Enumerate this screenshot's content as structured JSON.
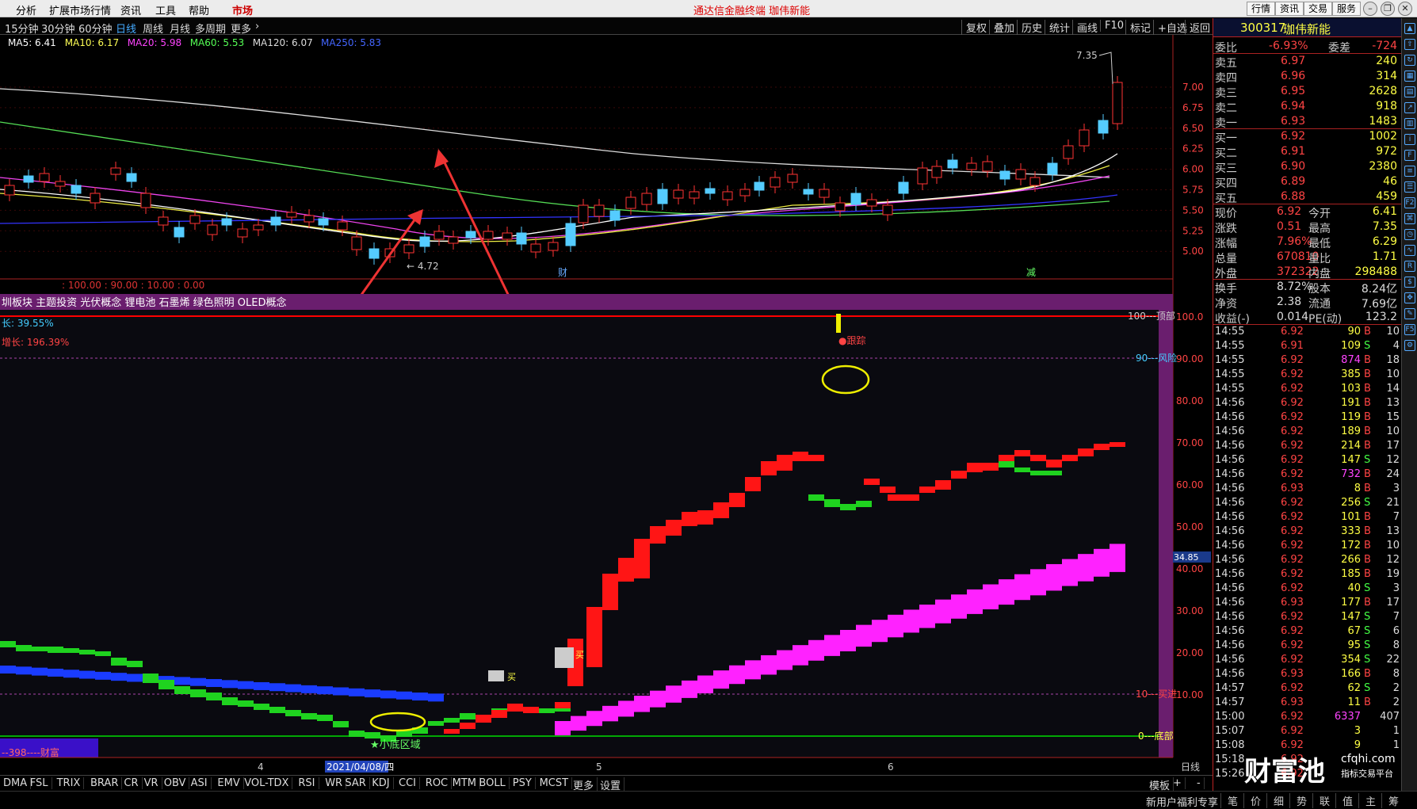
{
  "menu": {
    "items": [
      "分析",
      "扩展市场行情",
      "资讯",
      "工具",
      "帮助"
    ],
    "market": "市场",
    "title": "通达信金融终端 珈伟新能",
    "right_buttons": [
      "行情",
      "资讯",
      "交易",
      "服务"
    ],
    "window_icons": [
      "minimize-icon",
      "restore-icon",
      "close-icon"
    ]
  },
  "toolbar": {
    "periods": [
      "15分钟",
      "30分钟",
      "60分钟",
      "日线",
      "周线",
      "月线",
      "多周期",
      "更多"
    ],
    "active_period": "日线",
    "right_buttons": [
      "复权",
      "叠加",
      "历史",
      "统计",
      "画线",
      "F10",
      "标记",
      "+自选",
      "返回"
    ]
  },
  "ma_legend": [
    {
      "label": "MA5: 6.41",
      "color": "#ffffff"
    },
    {
      "label": "MA10: 6.17",
      "color": "#ffff55"
    },
    {
      "label": "MA20: 5.98",
      "color": "#ff44ff"
    },
    {
      "label": "MA60: 5.53",
      "color": "#55ff55"
    },
    {
      "label": "MA120: 6.07",
      "color": "#dddddd"
    },
    {
      "label": "MA250: 5.83",
      "color": "#4466ff"
    }
  ],
  "price_axis": [
    "7.00",
    "6.75",
    "6.50",
    "6.25",
    "6.00",
    "5.75",
    "5.50",
    "5.25",
    "5.00"
  ],
  "price_labels": {
    "high": "7.35",
    "low": "4.72",
    "marker_cai": "财",
    "marker_jian": "减"
  },
  "indicator_ticker": ": 100.00 : 90.00 : 10.00 : 0.00",
  "concept_strip": "圳板块 主题投资 光伏概念 锂电池 石墨烯 绿色照明 OLED概念",
  "indicator_texts": {
    "stat1": "长: 39.55%",
    "stat2": "增长: 196.39%",
    "top_label": "100---顶部",
    "risk_label": "90---风险",
    "buy_label": "10---买进",
    "bottom_label": "0---底部",
    "track_label": "●跟踪",
    "buy_marker": "买",
    "small_bottom": "★小底区域",
    "wealth": "--398----财富",
    "axis_value": "34.85"
  },
  "indicator_axis": [
    "100.0",
    "90.00",
    "80.00",
    "70.00",
    "60.00",
    "50.00",
    "40.00",
    "30.00",
    "20.00",
    "10.00"
  ],
  "date_axis": {
    "m4": "4",
    "date": "2021/04/08/四",
    "m5": "5",
    "m6": "6",
    "period": "日线"
  },
  "quote": {
    "code": "300317",
    "name": "珈伟新能",
    "weibi": {
      "label": "委比",
      "value": "-6.93%",
      "label2": "委差",
      "value2": "-724"
    },
    "asks": [
      {
        "label": "卖五",
        "price": "6.97",
        "vol": "240"
      },
      {
        "label": "卖四",
        "price": "6.96",
        "vol": "314"
      },
      {
        "label": "卖三",
        "price": "6.95",
        "vol": "2628"
      },
      {
        "label": "卖二",
        "price": "6.94",
        "vol": "918"
      },
      {
        "label": "卖一",
        "price": "6.93",
        "vol": "1483"
      }
    ],
    "bids": [
      {
        "label": "买一",
        "price": "6.92",
        "vol": "1002"
      },
      {
        "label": "买二",
        "price": "6.91",
        "vol": "972"
      },
      {
        "label": "买三",
        "price": "6.90",
        "vol": "2380"
      },
      {
        "label": "买四",
        "price": "6.89",
        "vol": "46"
      },
      {
        "label": "买五",
        "price": "6.88",
        "vol": "459"
      }
    ],
    "stats": [
      {
        "l1": "现价",
        "v1": "6.92",
        "l2": "今开",
        "v2": "6.41"
      },
      {
        "l1": "涨跌",
        "v1": "0.51",
        "l2": "最高",
        "v2": "7.35"
      },
      {
        "l1": "涨幅",
        "v1": "7.96%",
        "l2": "最低",
        "v2": "6.29"
      },
      {
        "l1": "总量",
        "v1": "670810",
        "l2": "量比",
        "v2": "1.71"
      },
      {
        "l1": "外盘",
        "v1": "372322",
        "l2": "内盘",
        "v2": "298488"
      }
    ],
    "stats2": [
      {
        "l1": "换手",
        "v1": "8.72%",
        "l2": "股本",
        "v2": "8.24亿"
      },
      {
        "l1": "净资",
        "v1": "2.38",
        "l2": "流通",
        "v2": "7.69亿"
      },
      {
        "l1": "收益(-)",
        "v1": "0.014",
        "l2": "PE(动)",
        "v2": "123.2"
      }
    ],
    "ticks": [
      {
        "t": "14:55",
        "p": "6.92",
        "v": "90",
        "bs": "B",
        "n": "10"
      },
      {
        "t": "14:55",
        "p": "6.91",
        "v": "109",
        "bs": "S",
        "n": "4"
      },
      {
        "t": "14:55",
        "p": "6.92",
        "v": "874",
        "bs": "B",
        "n": "18"
      },
      {
        "t": "14:55",
        "p": "6.92",
        "v": "385",
        "bs": "B",
        "n": "10"
      },
      {
        "t": "14:55",
        "p": "6.92",
        "v": "103",
        "bs": "B",
        "n": "14"
      },
      {
        "t": "14:56",
        "p": "6.92",
        "v": "191",
        "bs": "B",
        "n": "13"
      },
      {
        "t": "14:56",
        "p": "6.92",
        "v": "119",
        "bs": "B",
        "n": "15"
      },
      {
        "t": "14:56",
        "p": "6.92",
        "v": "189",
        "bs": "B",
        "n": "10"
      },
      {
        "t": "14:56",
        "p": "6.92",
        "v": "214",
        "bs": "B",
        "n": "17"
      },
      {
        "t": "14:56",
        "p": "6.92",
        "v": "147",
        "bs": "S",
        "n": "12"
      },
      {
        "t": "14:56",
        "p": "6.92",
        "v": "732",
        "bs": "B",
        "n": "24"
      },
      {
        "t": "14:56",
        "p": "6.93",
        "v": "8",
        "bs": "B",
        "n": "3"
      },
      {
        "t": "14:56",
        "p": "6.92",
        "v": "256",
        "bs": "S",
        "n": "21"
      },
      {
        "t": "14:56",
        "p": "6.92",
        "v": "101",
        "bs": "B",
        "n": "7"
      },
      {
        "t": "14:56",
        "p": "6.92",
        "v": "333",
        "bs": "B",
        "n": "13"
      },
      {
        "t": "14:56",
        "p": "6.92",
        "v": "172",
        "bs": "B",
        "n": "10"
      },
      {
        "t": "14:56",
        "p": "6.92",
        "v": "266",
        "bs": "B",
        "n": "12"
      },
      {
        "t": "14:56",
        "p": "6.92",
        "v": "185",
        "bs": "B",
        "n": "19"
      },
      {
        "t": "14:56",
        "p": "6.92",
        "v": "40",
        "bs": "S",
        "n": "3"
      },
      {
        "t": "14:56",
        "p": "6.93",
        "v": "177",
        "bs": "B",
        "n": "17"
      },
      {
        "t": "14:56",
        "p": "6.92",
        "v": "147",
        "bs": "S",
        "n": "7"
      },
      {
        "t": "14:56",
        "p": "6.92",
        "v": "67",
        "bs": "S",
        "n": "6"
      },
      {
        "t": "14:56",
        "p": "6.92",
        "v": "95",
        "bs": "S",
        "n": "8"
      },
      {
        "t": "14:56",
        "p": "6.92",
        "v": "354",
        "bs": "S",
        "n": "22"
      },
      {
        "t": "14:56",
        "p": "6.93",
        "v": "166",
        "bs": "B",
        "n": "8"
      },
      {
        "t": "14:57",
        "p": "6.92",
        "v": "62",
        "bs": "S",
        "n": "2"
      },
      {
        "t": "14:57",
        "p": "6.93",
        "v": "11",
        "bs": "B",
        "n": "2"
      },
      {
        "t": "15:00",
        "p": "6.92",
        "v": "6337",
        "bs": "",
        "n": "407"
      },
      {
        "t": "15:07",
        "p": "6.92",
        "v": "3",
        "bs": "",
        "n": "1"
      },
      {
        "t": "15:08",
        "p": "6.92",
        "v": "9",
        "bs": "",
        "n": "1"
      },
      {
        "t": "15:18",
        "p": "6.92",
        "v": "",
        "bs": "",
        "n": ""
      },
      {
        "t": "15:26",
        "p": "6.92",
        "v": "",
        "bs": "",
        "n": ""
      }
    ]
  },
  "indicator_tabs": [
    "DMA",
    "FSL",
    "TRIX",
    "BRAR",
    "CR",
    "VR",
    "OBV",
    "ASI",
    "EMV",
    "VOL-TDX",
    "RSI",
    "WR",
    "SAR",
    "KDJ",
    "CCI",
    "ROC",
    "MTM",
    "BOLL",
    "PSY",
    "MCST",
    "更多",
    "设置"
  ],
  "bottom_right": [
    "模板",
    "+",
    "-"
  ],
  "status_left": "新用户福利专享",
  "status_tabs": [
    "笔",
    "价",
    "细",
    "势",
    "联",
    "值",
    "主",
    "筹"
  ],
  "watermark": {
    "cn": "财富池",
    "en": "cfqhi.com",
    "sub": "指标交易平台"
  }
}
